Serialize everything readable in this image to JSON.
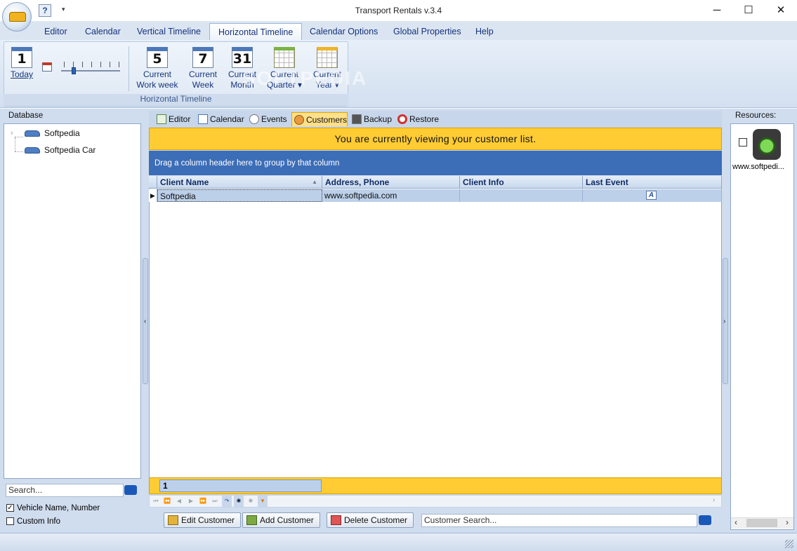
{
  "window": {
    "title": "Transport Rentals v.3.4",
    "help_label": "?",
    "more_label": "▾",
    "minimize": "─",
    "maximize": "☐",
    "close": "✕"
  },
  "menu": {
    "tabs": [
      {
        "label": "Editor"
      },
      {
        "label": "Calendar"
      },
      {
        "label": "Vertical Timeline"
      },
      {
        "label": "Horizontal Timeline"
      },
      {
        "label": "Calendar Options"
      },
      {
        "label": "Global Properties"
      },
      {
        "label": "Help"
      }
    ],
    "active": "Horizontal Timeline"
  },
  "ribbon": {
    "group_label": "Horizontal Timeline",
    "today": {
      "number": "1",
      "label": "Today"
    },
    "buttons": [
      {
        "number": "5",
        "line1": "Current",
        "line2": "Work week"
      },
      {
        "number": "7",
        "line1": "Current",
        "line2": "Week"
      },
      {
        "number": "31",
        "line1": "Current",
        "line2": "Month"
      },
      {
        "line1": "Current",
        "line2": "Quarter ▾"
      },
      {
        "line1": "Current",
        "line2": "Year ▾"
      }
    ],
    "watermark": "SOFTPEDIA"
  },
  "database": {
    "title": "Database",
    "expander": "›",
    "items": [
      {
        "label": "Softpedia"
      },
      {
        "label": "Softpedia Car"
      }
    ],
    "search_placeholder": "Search...",
    "filters": [
      {
        "label": "Vehicle Name, Number",
        "checked": true
      },
      {
        "label": "Custom Info",
        "checked": false
      }
    ]
  },
  "content_tabs": [
    {
      "label": "Editor"
    },
    {
      "label": "Calendar"
    },
    {
      "label": "Events"
    },
    {
      "label": "Customers"
    },
    {
      "label": "Backup"
    },
    {
      "label": "Restore"
    }
  ],
  "active_tab": "Customers",
  "banner": "You are currently viewing your customer list.",
  "group_hint": "Drag a column header here to group by that column",
  "grid": {
    "columns": [
      "Client Name",
      "Address, Phone",
      "Client Info",
      "Last Event"
    ],
    "sort_indicator": "▲",
    "row_marker": "▶",
    "rows": [
      {
        "client_name": "Softpedia",
        "address_phone": "www.softpedia.com",
        "client_info": "",
        "last_event": "A"
      }
    ],
    "footer_count": "1"
  },
  "navigator": [
    "⏮",
    "⏪",
    "◀",
    "▶",
    "⏩",
    "⏭",
    "↷",
    "✱",
    "✱",
    "▼"
  ],
  "actions": {
    "edit": "Edit Customer",
    "add": "Add Customer",
    "delete": "Delete Customer",
    "search_placeholder": "Customer Search..."
  },
  "resources": {
    "title": "Resources:",
    "items": [
      {
        "label": "www.softpedi..."
      }
    ],
    "scroll_left": "‹",
    "scroll_right": "›"
  },
  "splitters": {
    "left_arrow": "‹",
    "right_arrow": "›"
  },
  "colors": {
    "banner": "#ffcc33",
    "group_panel": "#3c6db7",
    "selected_row": "#bcd0ea",
    "ribbon_text": "#16357a"
  }
}
